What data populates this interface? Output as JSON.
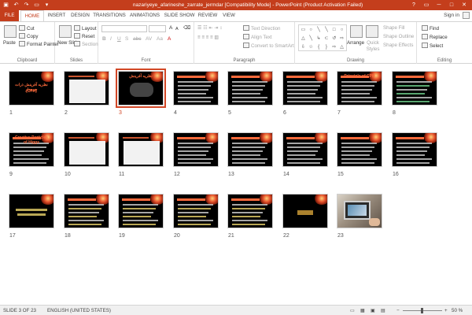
{
  "title_bar": {
    "title": "nazariyeye_afarineshe_zarrate_jermdar [Compatibility Mode] - PowerPoint (Product Activation Failed)",
    "qat": {
      "save_icon": "save-icon",
      "undo_icon": "undo-icon",
      "redo_icon": "redo-icon",
      "present_icon": "start-presentation-icon",
      "customize_icon": "customize-qat-icon"
    },
    "window_controls": {
      "help": "?",
      "restore_ribbon": "▭",
      "minimize": "─",
      "maximize": "□",
      "close": "✕"
    }
  },
  "tabs": [
    "FILE",
    "HOME",
    "INSERT",
    "DESIGN",
    "TRANSITIONS",
    "ANIMATIONS",
    "SLIDE SHOW",
    "REVIEW",
    "VIEW"
  ],
  "active_tab": "HOME",
  "sign_in": "Sign in",
  "ribbon": {
    "clipboard": {
      "paste": "Paste",
      "cut": "Cut",
      "copy": "Copy",
      "format_painter": "Format Painter",
      "label": "Clipboard"
    },
    "slides": {
      "new_slide": "New Slide",
      "layout": "Layout",
      "reset": "Reset",
      "section": "Section",
      "label": "Slides"
    },
    "font": {
      "label": "Font",
      "buttons": [
        "B",
        "I",
        "U",
        "S",
        "abc",
        "AV",
        "Aa",
        "A"
      ],
      "grow": "A",
      "shrink": "A"
    },
    "paragraph": {
      "text_direction": "Text Direction",
      "align_text": "Align Text",
      "convert_smartart": "Convert to SmartArt",
      "label": "Paragraph"
    },
    "drawing": {
      "label": "Drawing",
      "arrange": "Arrange",
      "quick_styles": "Quick Styles",
      "shape_fill": "Shape Fill",
      "shape_outline": "Shape Outline",
      "shape_effects": "Shape Effects",
      "shapes": [
        "▭",
        "○",
        "╲",
        "╲",
        "□",
        "○",
        "△",
        "╲",
        "↳",
        "⊂",
        "↺",
        "⇨",
        "⇩",
        "☆",
        "{",
        "}",
        "⇨",
        "△"
      ]
    },
    "editing": {
      "find": "Find",
      "replace": "Replace",
      "select": "Select",
      "label": "Editing"
    }
  },
  "slides": [
    {
      "num": "1",
      "kind": "title",
      "big": "نظریه آفرینش ذرات جرمدار",
      "sub": "(CPH)"
    },
    {
      "num": "2",
      "kind": "white-table"
    },
    {
      "num": "3",
      "kind": "title-dark",
      "big": "نظریه آفرینش",
      "selected": true
    },
    {
      "num": "4",
      "kind": "text"
    },
    {
      "num": "5",
      "kind": "text"
    },
    {
      "num": "6",
      "kind": "text"
    },
    {
      "num": "7",
      "kind": "text",
      "big": "Principle of CPH"
    },
    {
      "num": "8",
      "kind": "text-green"
    },
    {
      "num": "9",
      "kind": "diagram",
      "big": "Creative Particles of Higgs"
    },
    {
      "num": "10",
      "kind": "white-diagram"
    },
    {
      "num": "11",
      "kind": "white-graph"
    },
    {
      "num": "12",
      "kind": "text"
    },
    {
      "num": "13",
      "kind": "text"
    },
    {
      "num": "14",
      "kind": "text"
    },
    {
      "num": "15",
      "kind": "text"
    },
    {
      "num": "16",
      "kind": "text"
    },
    {
      "num": "17",
      "kind": "yellow-center"
    },
    {
      "num": "18",
      "kind": "text-pink"
    },
    {
      "num": "19",
      "kind": "text-pink"
    },
    {
      "num": "20",
      "kind": "text-pink"
    },
    {
      "num": "21",
      "kind": "text-pink"
    },
    {
      "num": "22",
      "kind": "logo"
    },
    {
      "num": "23",
      "kind": "photo"
    }
  ],
  "status_bar": {
    "slide_counter": "SLIDE 3 OF 23",
    "language": "ENGLISH (UNITED STATES)",
    "zoom": "50 %",
    "normal_view_icon": "normal-view-icon",
    "sorter_view_icon": "slide-sorter-view-icon",
    "reading_view_icon": "reading-view-icon",
    "slideshow_icon": "slideshow-view-icon",
    "zoom_minus": "−",
    "zoom_plus": "+"
  }
}
